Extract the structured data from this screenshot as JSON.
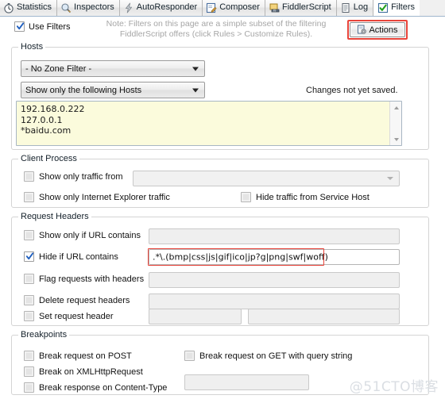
{
  "tabs": [
    {
      "id": "statistics",
      "label": "Statistics",
      "icon": "stopwatch-icon",
      "active": false
    },
    {
      "id": "inspectors",
      "label": "Inspectors",
      "icon": "magnifier-icon",
      "active": false
    },
    {
      "id": "autoresponder",
      "label": "AutoResponder",
      "icon": "lightning-icon",
      "active": false
    },
    {
      "id": "composer",
      "label": "Composer",
      "icon": "pencil-pad-icon",
      "active": false
    },
    {
      "id": "fiddlerscript",
      "label": "FiddlerScript",
      "icon": "js-script-icon",
      "active": false
    },
    {
      "id": "log",
      "label": "Log",
      "icon": "document-icon",
      "active": false
    },
    {
      "id": "filters",
      "label": "Filters",
      "icon": "green-check-icon",
      "active": true
    }
  ],
  "header": {
    "use_filters_label": "Use Filters",
    "use_filters_checked": true,
    "note_line1": "Note: Filters on this page are a simple subset of the filtering",
    "note_line2": "FiddlerScript offers (click Rules > Customize Rules).",
    "actions_label": "Actions",
    "actions_highlighted": true
  },
  "hosts": {
    "legend": "Hosts",
    "zone_filter_value": "- No Zone Filter -",
    "host_filter_value": "Show only the following Hosts",
    "host_list": "192.168.0.222\n127.0.0.1\n*baidu.com",
    "status": "Changes not yet saved."
  },
  "client_process": {
    "legend": "Client Process",
    "show_only_traffic_from_label": "Show only traffic from",
    "show_only_traffic_from_checked": false,
    "process_combo_value": "",
    "show_only_ie_label": "Show only Internet Explorer traffic",
    "show_only_ie_checked": false,
    "hide_service_host_label": "Hide traffic from Service Host",
    "hide_service_host_checked": false
  },
  "request_headers": {
    "legend": "Request Headers",
    "show_only_if_url_label": "Show only if URL contains",
    "show_only_if_url_checked": false,
    "show_only_if_url_value": "",
    "hide_if_url_label": "Hide if URL contains",
    "hide_if_url_checked": true,
    "hide_if_url_value": ".*\\.(bmp|css|js|gif|ico|jp?g|png|swf|woff)",
    "hide_if_url_highlighted": true,
    "flag_requests_label": "Flag requests with headers",
    "flag_requests_checked": false,
    "flag_requests_value": "",
    "delete_headers_label": "Delete request headers",
    "delete_headers_checked": false,
    "delete_headers_value": "",
    "set_header_label": "Set request header",
    "set_header_checked": false,
    "set_header_name_value": "",
    "set_header_value_value": ""
  },
  "breakpoints": {
    "legend": "Breakpoints",
    "break_post_label": "Break request on POST",
    "break_post_checked": false,
    "break_get_label": "Break request on GET with query string",
    "break_get_checked": false,
    "break_xhr_label": "Break on XMLHttpRequest",
    "break_xhr_checked": false,
    "break_content_type_label": "Break response on Content-Type",
    "break_content_type_checked": false,
    "break_content_type_value": ""
  },
  "watermark": "@51CTO博客",
  "colors": {
    "highlight": "#e8443a",
    "hosts_background": "#fbfbdc",
    "note_text": "#a6a6a6",
    "check_blue": "#1f5fbf",
    "check_green": "#23a01e"
  }
}
